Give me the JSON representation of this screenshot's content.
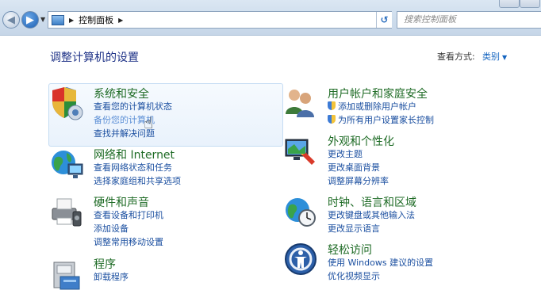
{
  "toolbar": {
    "breadcrumb": "控制面板",
    "search_placeholder": "搜索控制面板"
  },
  "header": {
    "title": "调整计算机的设置",
    "view_by_label": "查看方式:",
    "view_by_value": "类别"
  },
  "left_categories": [
    {
      "title": "系统和安全",
      "links": [
        "查看您的计算机状态",
        "备份您的计算机",
        "查找并解决问题"
      ]
    },
    {
      "title": "网络和 Internet",
      "links": [
        "查看网络状态和任务",
        "选择家庭组和共享选项"
      ]
    },
    {
      "title": "硬件和声音",
      "links": [
        "查看设备和打印机",
        "添加设备",
        "调整常用移动设置"
      ]
    },
    {
      "title": "程序",
      "links": [
        "卸载程序"
      ]
    }
  ],
  "right_categories": [
    {
      "title": "用户帐户和家庭安全",
      "links": [
        "添加或删除用户帐户",
        "为所有用户设置家长控制"
      ]
    },
    {
      "title": "外观和个性化",
      "links": [
        "更改主题",
        "更改桌面背景",
        "调整屏幕分辨率"
      ]
    },
    {
      "title": "时钟、语言和区域",
      "links": [
        "更改键盘或其他输入法",
        "更改显示语言"
      ]
    },
    {
      "title": "轻松访问",
      "links": [
        "使用 Windows 建议的设置",
        "优化视频显示"
      ]
    }
  ],
  "icons": {
    "system_security": "shield-icon",
    "network": "globe-network-icon",
    "hardware": "printer-icon",
    "programs": "programs-box-icon",
    "user_accounts": "users-icon",
    "appearance": "monitor-paint-icon",
    "clock": "globe-clock-icon",
    "ease_of_access": "ease-of-access-icon"
  },
  "colors": {
    "category_title": "#1e6b25",
    "link": "#1b4fa0",
    "page_title": "#1e3287"
  }
}
